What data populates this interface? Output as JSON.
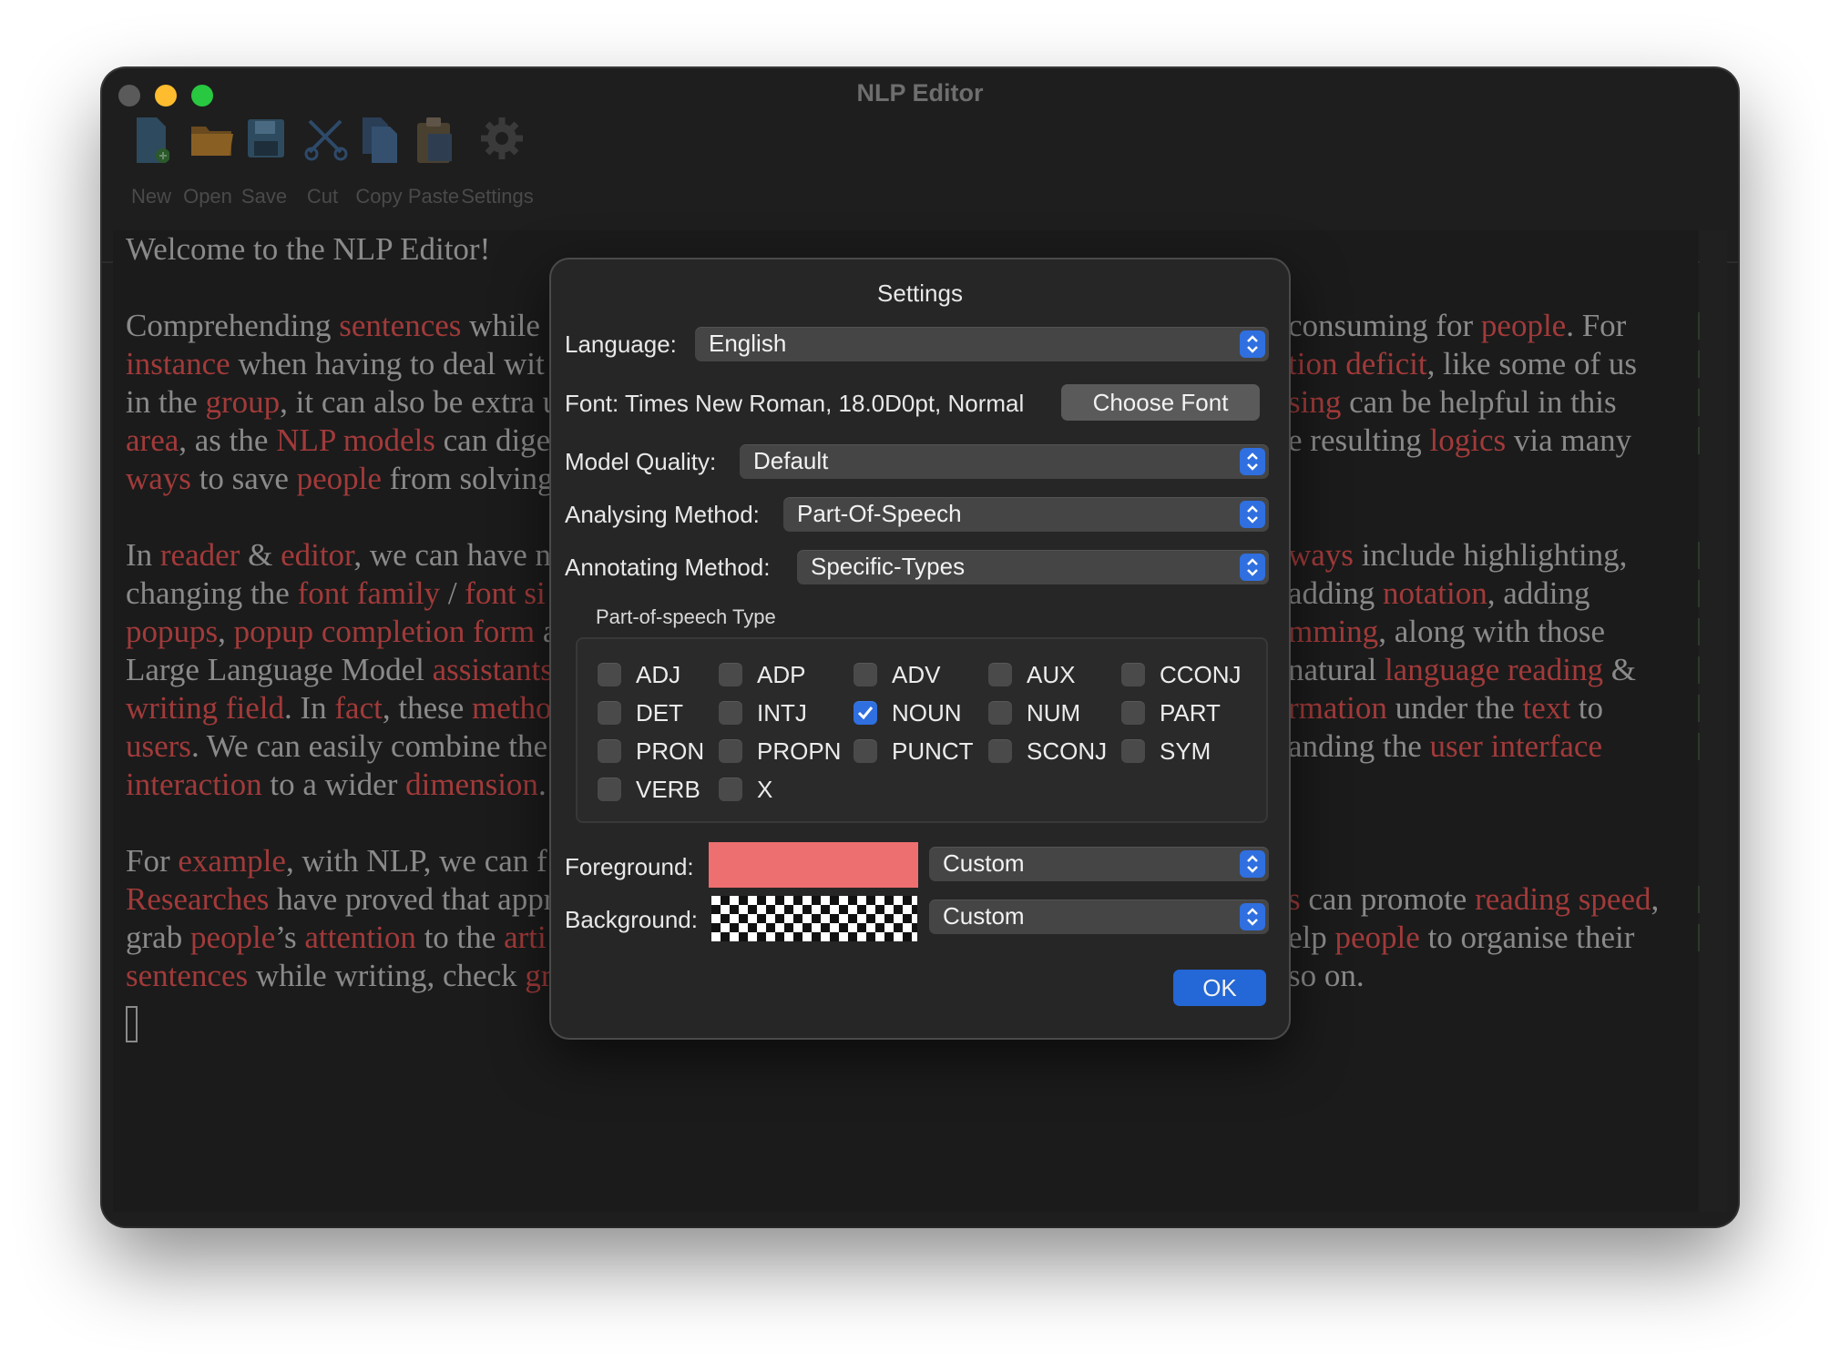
{
  "window": {
    "title": "NLP Editor"
  },
  "toolbar": {
    "items": [
      {
        "label": "New",
        "icon": "new-document-icon"
      },
      {
        "label": "Open",
        "icon": "folder-icon"
      },
      {
        "label": "Save",
        "icon": "floppy-disk-icon"
      },
      {
        "label": "Cut",
        "icon": "scissors-icon"
      },
      {
        "label": "Copy",
        "icon": "copy-icon"
      },
      {
        "label": "Paste",
        "icon": "clipboard-icon"
      },
      {
        "label": "Settings",
        "icon": "gear-icon"
      }
    ]
  },
  "editor": {
    "lines": [
      [
        "Welcome to the NLP Editor!"
      ],
      [],
      [
        "Comprehending ",
        {
          "h": "sentences"
        },
        " while "
      ],
      [
        {
          "h": "instance"
        },
        " when having to deal wit"
      ],
      [
        "in the ",
        {
          "h": "group"
        },
        ", it can also be extra u"
      ],
      [
        {
          "h": "area"
        },
        ", as the ",
        {
          "h": "NLP models"
        },
        " can dige"
      ],
      [
        {
          "h": "ways"
        },
        " to save ",
        {
          "h": "people"
        },
        " from solving"
      ],
      [],
      [
        "In ",
        {
          "h": "reader"
        },
        " & ",
        {
          "h": "editor"
        },
        ", we can have n"
      ],
      [
        "changing the ",
        {
          "h": "font family"
        },
        " / ",
        {
          "h": "font si"
        }
      ],
      [
        {
          "h": "popups"
        },
        ", ",
        {
          "h": "popup completion form"
        },
        " a"
      ],
      [
        "Large Language Model ",
        {
          "h": "assistants"
        }
      ],
      [
        {
          "h": "writing field"
        },
        ". In ",
        {
          "h": "fact"
        },
        ", these ",
        {
          "h": "metho"
        }
      ],
      [
        {
          "h": "users"
        },
        ". We can easily combine the"
      ],
      [
        {
          "h": "interaction"
        },
        " to a wider ",
        {
          "h": "dimension"
        },
        "."
      ],
      [],
      [
        "For ",
        {
          "h": "example"
        },
        ", with NLP, we can f"
      ],
      [
        {
          "h": "Researches"
        },
        " have proved that appr"
      ],
      [
        "grab ",
        {
          "h": "people"
        },
        "’s ",
        {
          "h": "attention"
        },
        " to the ",
        {
          "h": "arti"
        }
      ],
      [
        {
          "h": "sentences"
        },
        " while writing, check ",
        {
          "h": "gr"
        }
      ]
    ],
    "right_lines": [
      [],
      [],
      [
        "consuming for ",
        {
          "h": "people"
        },
        ". For"
      ],
      [
        {
          "h": "tion deficit"
        },
        ", like some of us"
      ],
      [
        {
          "h": "sing"
        },
        " can be helpful in this"
      ],
      [
        "e resulting ",
        {
          "h": "logics"
        },
        " via many"
      ],
      [],
      [],
      [
        {
          "h": " ways"
        },
        " include highlighting,"
      ],
      [
        "adding ",
        {
          "h": "notation"
        },
        ", adding"
      ],
      [
        {
          "h": "mming"
        },
        ", along with those"
      ],
      [
        "natural ",
        {
          "h": "language reading"
        },
        " &"
      ],
      [
        {
          "h": "rmation"
        },
        " under the ",
        {
          "h": "text"
        },
        " to"
      ],
      [
        "anding the ",
        {
          "h": "user interface"
        }
      ],
      [],
      [],
      [],
      [
        {
          "h": "s"
        },
        " can promote ",
        {
          "h": "reading speed"
        },
        ","
      ],
      [
        "elp ",
        {
          "h": "people"
        },
        " to organise their"
      ],
      [
        "so on."
      ]
    ],
    "marker_glyph": "»"
  },
  "dialog": {
    "title": "Settings",
    "language_label": "Language:",
    "language_value": "English",
    "font_label": "Font: Times New Roman, 18.0D0pt, Normal",
    "choose_font": "Choose Font",
    "model_quality_label": "Model Quality:",
    "model_quality_value": "Default",
    "analysing_label": "Analysing Method:",
    "analysing_value": "Part-Of-Speech",
    "annotating_label": "Annotating Method:",
    "annotating_value": "Specific-Types",
    "pos_group_title": "Part-of-speech Type",
    "pos_types": [
      {
        "name": "ADJ",
        "checked": false
      },
      {
        "name": "ADP",
        "checked": false
      },
      {
        "name": "ADV",
        "checked": false
      },
      {
        "name": "AUX",
        "checked": false
      },
      {
        "name": "CCONJ",
        "checked": false
      },
      {
        "name": "DET",
        "checked": false
      },
      {
        "name": "INTJ",
        "checked": false
      },
      {
        "name": "NOUN",
        "checked": true
      },
      {
        "name": "NUM",
        "checked": false
      },
      {
        "name": "PART",
        "checked": false
      },
      {
        "name": "PRON",
        "checked": false
      },
      {
        "name": "PROPN",
        "checked": false
      },
      {
        "name": "PUNCT",
        "checked": false
      },
      {
        "name": "SCONJ",
        "checked": false
      },
      {
        "name": "SYM",
        "checked": false
      },
      {
        "name": "VERB",
        "checked": false
      },
      {
        "name": "X",
        "checked": false
      }
    ],
    "foreground_label": "Foreground:",
    "foreground_color": "#ee6f6f",
    "foreground_mode": "Custom",
    "background_label": "Background:",
    "background_mode": "Custom",
    "ok": "OK"
  },
  "colors": {
    "accent": "#2467d6",
    "highlight_text": "#a23a3a",
    "editor_text": "#8a8a8a"
  }
}
